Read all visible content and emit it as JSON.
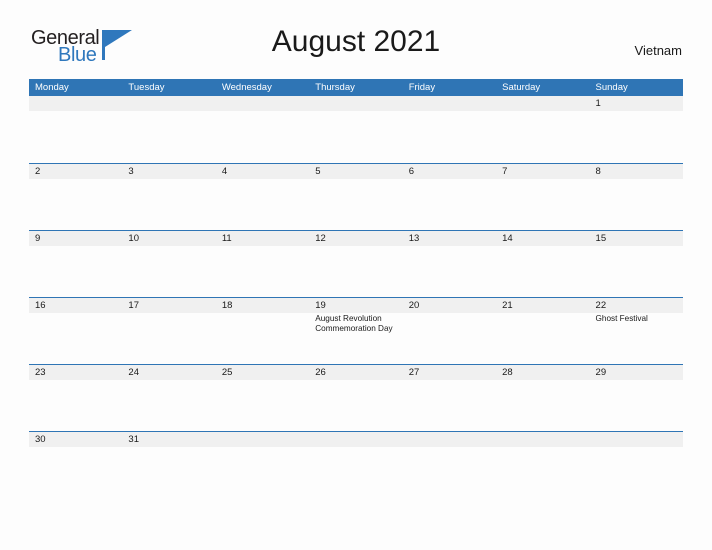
{
  "brand": {
    "logo_name_top": "General",
    "logo_name_bottom": "Blue",
    "icon": "triangle-flag-icon",
    "color_primary": "#2f78bd",
    "color_text": "#231f20"
  },
  "header": {
    "title": "August 2021",
    "month": "August",
    "year": "2021",
    "region": "Vietnam"
  },
  "theme": {
    "header_blue": "#2f75b5",
    "row_divider_blue": "#2f75b5",
    "date_band_gray": "#f0f0f0",
    "page_background": "#fdfdfd",
    "text_dark": "#1a1a1a",
    "dow_text": "#ffffff"
  },
  "calendar": {
    "first_day_of_week": "Monday",
    "day_headers": [
      "Monday",
      "Tuesday",
      "Wednesday",
      "Thursday",
      "Friday",
      "Saturday",
      "Sunday"
    ],
    "weeks": [
      {
        "height": 67,
        "days": [
          {
            "num": "",
            "events": []
          },
          {
            "num": "",
            "events": []
          },
          {
            "num": "",
            "events": []
          },
          {
            "num": "",
            "events": []
          },
          {
            "num": "",
            "events": []
          },
          {
            "num": "",
            "events": []
          },
          {
            "num": "1",
            "events": []
          }
        ]
      },
      {
        "height": 67,
        "days": [
          {
            "num": "2",
            "events": []
          },
          {
            "num": "3",
            "events": []
          },
          {
            "num": "4",
            "events": []
          },
          {
            "num": "5",
            "events": []
          },
          {
            "num": "6",
            "events": []
          },
          {
            "num": "7",
            "events": []
          },
          {
            "num": "8",
            "events": []
          }
        ]
      },
      {
        "height": 67,
        "days": [
          {
            "num": "9",
            "events": []
          },
          {
            "num": "10",
            "events": []
          },
          {
            "num": "11",
            "events": []
          },
          {
            "num": "12",
            "events": []
          },
          {
            "num": "13",
            "events": []
          },
          {
            "num": "14",
            "events": []
          },
          {
            "num": "15",
            "events": []
          }
        ]
      },
      {
        "height": 67,
        "days": [
          {
            "num": "16",
            "events": []
          },
          {
            "num": "17",
            "events": []
          },
          {
            "num": "18",
            "events": []
          },
          {
            "num": "19",
            "events": [
              "August Revolution Commemoration Day"
            ]
          },
          {
            "num": "20",
            "events": []
          },
          {
            "num": "21",
            "events": []
          },
          {
            "num": "22",
            "events": [
              "Ghost Festival"
            ]
          }
        ]
      },
      {
        "height": 67,
        "days": [
          {
            "num": "23",
            "events": []
          },
          {
            "num": "24",
            "events": []
          },
          {
            "num": "25",
            "events": []
          },
          {
            "num": "26",
            "events": []
          },
          {
            "num": "27",
            "events": []
          },
          {
            "num": "28",
            "events": []
          },
          {
            "num": "29",
            "events": []
          }
        ]
      },
      {
        "height": 18,
        "days": [
          {
            "num": "30",
            "events": []
          },
          {
            "num": "31",
            "events": []
          },
          {
            "num": "",
            "events": []
          },
          {
            "num": "",
            "events": []
          },
          {
            "num": "",
            "events": []
          },
          {
            "num": "",
            "events": []
          },
          {
            "num": "",
            "events": []
          }
        ]
      }
    ]
  }
}
